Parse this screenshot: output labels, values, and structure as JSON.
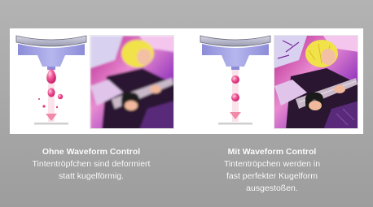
{
  "colors": {
    "background": "#a8a8a8",
    "panel": "#ffffff",
    "nozzle": "#7f7fd1",
    "droplet": "#e0357d",
    "arrow": "#f08aa8"
  },
  "captions": {
    "left": {
      "title": "Ohne Waveform Control",
      "line1": "Tintentröpfchen sind deformiert",
      "line2": "statt kugelförmig."
    },
    "right": {
      "title": "Mit Waveform Control",
      "line1": "Tintentröpchen werden in",
      "line2": "fast perfekter Kugelform",
      "line3": "ausgestoßen."
    }
  }
}
